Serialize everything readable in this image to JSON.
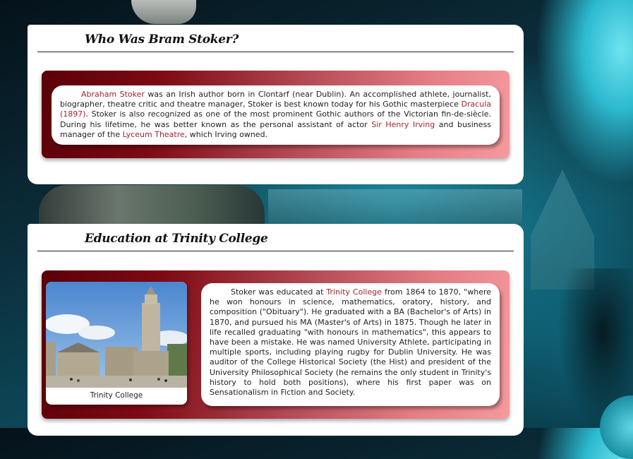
{
  "sections": [
    {
      "title": "Who Was Bram Stoker?",
      "paragraph": [
        {
          "text": "Abraham Stoker",
          "link": true
        },
        {
          "text": " was an Irish author born in Clontarf (near Dublin). An accomplished athlete, journalist, biographer, theatre critic and theatre manager, Stoker is best known today for his Gothic masterpiece ",
          "link": false
        },
        {
          "text": "Dracula (1897)",
          "link": true
        },
        {
          "text": ". Stoker is also recognized as one of the most prominent Gothic authors of the Victorian fin-de-siècle. During his lifetime, he was better known as the personal assistant of actor ",
          "link": false
        },
        {
          "text": "Sir Henry Irving",
          "link": true
        },
        {
          "text": " and business manager of the ",
          "link": false
        },
        {
          "text": "Lyceum Theatre",
          "link": true
        },
        {
          "text": ", which Irving owned.",
          "link": false
        }
      ]
    },
    {
      "title": "Education at Trinity College",
      "image_caption": "Trinity College",
      "paragraph": [
        {
          "text": "Stoker was educated at ",
          "link": false
        },
        {
          "text": "Trinity College",
          "link": true
        },
        {
          "text": " from 1864 to 1870, \"where he won honours in science, mathematics, oratory, history, and composition (\"Obituary\"). He graduated with a BA (Bachelor's of Arts) in 1870, and pursued his MA (Master's of Arts) in 1875. Though he later in life recalled graduating \"with honours in mathematics\", this appears to have been a mistake. He was named University Athlete, participating in multiple sports, including playing rugby for Dublin University. He was auditor of the College Historical Society (the Hist) and president of the University Philosophical Society (he remains the only student in Trinity's history to hold both positions), where his first paper was on Sensationalism in Fiction and Society.",
          "link": false
        }
      ]
    }
  ],
  "colors": {
    "link": "#a3262e",
    "band_dark": "#5a0008",
    "band_light": "#f59a9e",
    "card": "#ffffff"
  }
}
